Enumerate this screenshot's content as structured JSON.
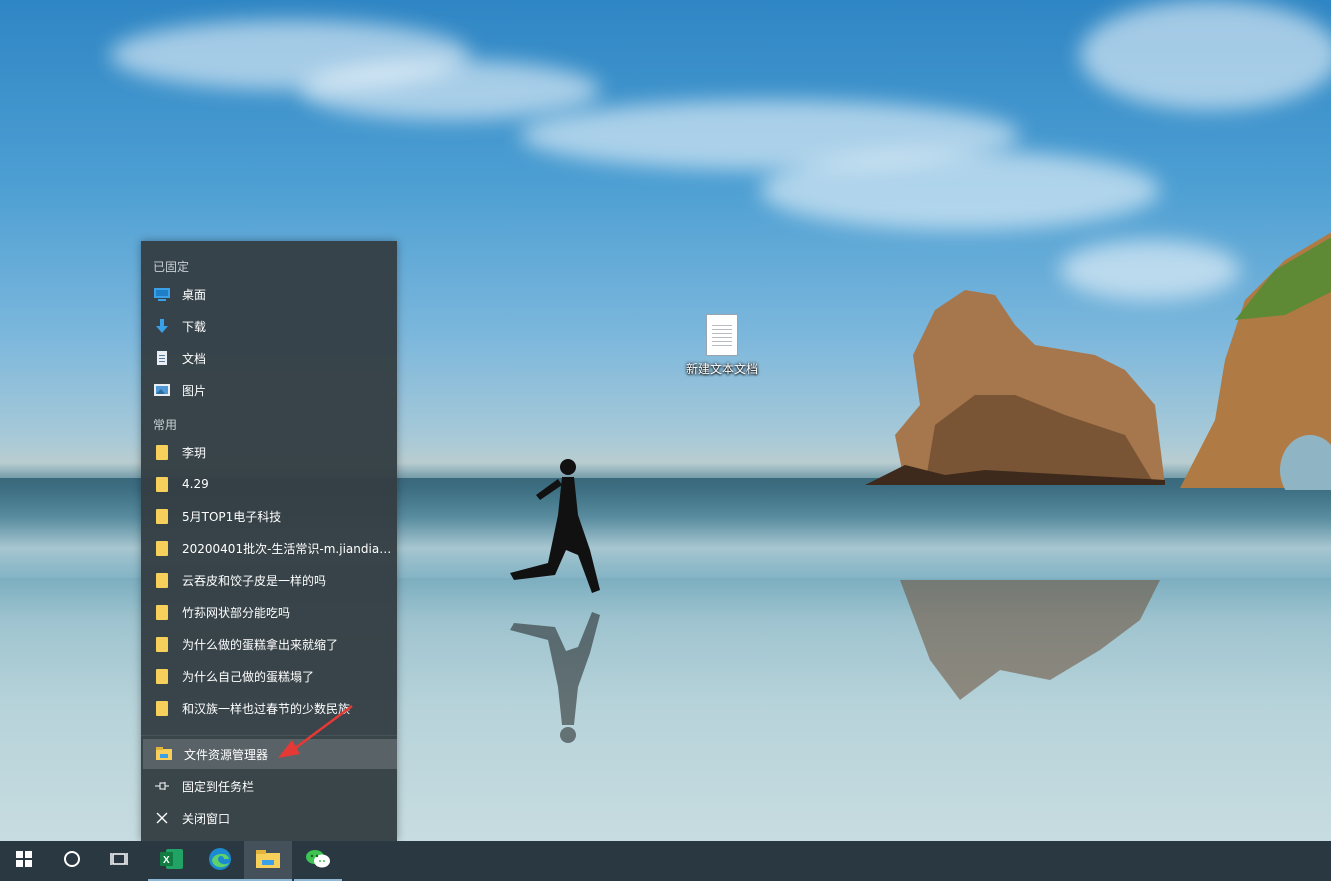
{
  "desktop": {
    "icons": [
      {
        "label": "新建文本文档",
        "icon": "text-document-icon"
      }
    ]
  },
  "jumplist": {
    "pinned_title": "已固定",
    "pinned": [
      {
        "label": "桌面",
        "icon": "desktop-icon"
      },
      {
        "label": "下载",
        "icon": "download-icon"
      },
      {
        "label": "文档",
        "icon": "document-icon"
      },
      {
        "label": "图片",
        "icon": "pictures-icon"
      }
    ],
    "frequent_title": "常用",
    "frequent": [
      {
        "label": "李玥",
        "icon": "folder-icon"
      },
      {
        "label": "4.29",
        "icon": "folder-icon"
      },
      {
        "label": "5月TOP1电子科技",
        "icon": "folder-icon"
      },
      {
        "label": "20200401批次-生活常识-m.jiandiao....",
        "icon": "folder-icon"
      },
      {
        "label": "云吞皮和饺子皮是一样的吗",
        "icon": "folder-icon"
      },
      {
        "label": "竹荪网状部分能吃吗",
        "icon": "folder-icon"
      },
      {
        "label": "为什么做的蛋糕拿出来就缩了",
        "icon": "folder-icon"
      },
      {
        "label": "为什么自己做的蛋糕塌了",
        "icon": "folder-icon"
      },
      {
        "label": "和汉族一样也过春节的少数民族",
        "icon": "folder-icon"
      }
    ],
    "actions": [
      {
        "label": "文件资源管理器",
        "icon": "file-explorer-icon",
        "highlighted": true
      },
      {
        "label": "固定到任务栏",
        "icon": "pin-icon"
      },
      {
        "label": "关闭窗口",
        "icon": "close-icon"
      }
    ]
  },
  "taskbar": {
    "items": [
      {
        "name": "start-button",
        "icon": "windows-logo-icon"
      },
      {
        "name": "search-button",
        "icon": "cortana-circle-icon"
      },
      {
        "name": "task-view-button",
        "icon": "task-view-icon"
      },
      {
        "name": "excel-button",
        "icon": "excel-icon"
      },
      {
        "name": "edge-button",
        "icon": "edge-icon"
      },
      {
        "name": "file-explorer-button",
        "icon": "folder-icon",
        "active": true
      },
      {
        "name": "wechat-button",
        "icon": "wechat-icon"
      }
    ]
  },
  "colors": {
    "menu_bg": "#343e44",
    "taskbar_bg": "#2a3842",
    "folder_yellow": "#f7cf5b",
    "accent_blue": "#3aa0e8",
    "annotation_arrow": "#e53935"
  }
}
